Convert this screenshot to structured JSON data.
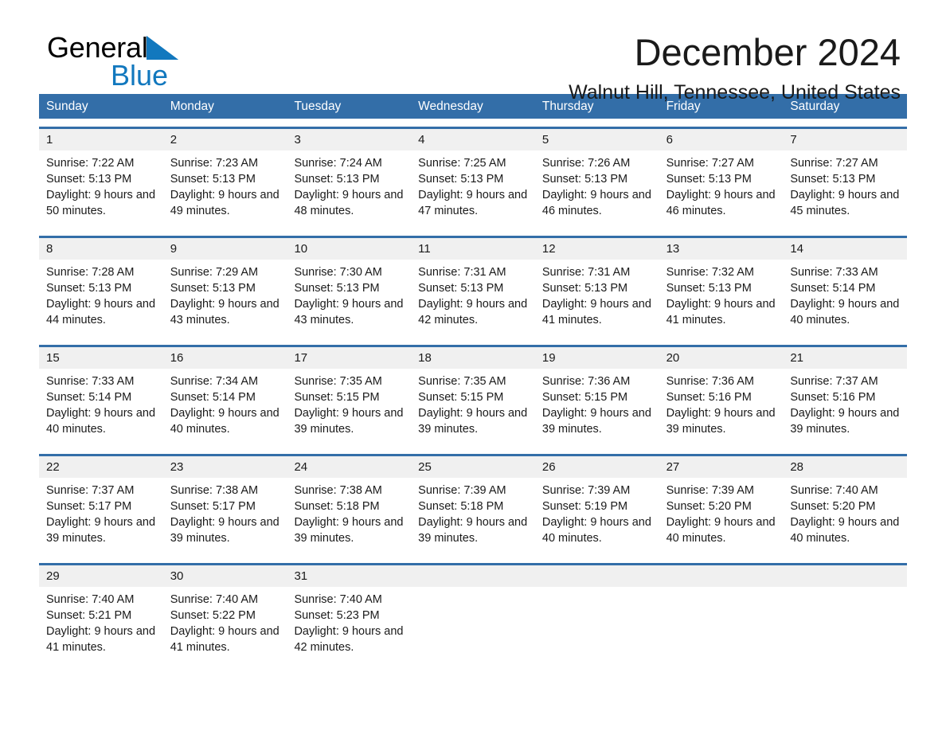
{
  "brand": {
    "name_part1": "General",
    "name_part2": "Blue",
    "triangle_color": "#1278be",
    "header_blue": "#336ea8"
  },
  "header": {
    "month_title": "December 2024",
    "location": "Walnut Hill, Tennessee, United States"
  },
  "weekdays": [
    "Sunday",
    "Monday",
    "Tuesday",
    "Wednesday",
    "Thursday",
    "Friday",
    "Saturday"
  ],
  "weeks": [
    {
      "days": [
        {
          "date": "1",
          "sunrise": "Sunrise: 7:22 AM",
          "sunset": "Sunset: 5:13 PM",
          "daylight": "Daylight: 9 hours and 50 minutes."
        },
        {
          "date": "2",
          "sunrise": "Sunrise: 7:23 AM",
          "sunset": "Sunset: 5:13 PM",
          "daylight": "Daylight: 9 hours and 49 minutes."
        },
        {
          "date": "3",
          "sunrise": "Sunrise: 7:24 AM",
          "sunset": "Sunset: 5:13 PM",
          "daylight": "Daylight: 9 hours and 48 minutes."
        },
        {
          "date": "4",
          "sunrise": "Sunrise: 7:25 AM",
          "sunset": "Sunset: 5:13 PM",
          "daylight": "Daylight: 9 hours and 47 minutes."
        },
        {
          "date": "5",
          "sunrise": "Sunrise: 7:26 AM",
          "sunset": "Sunset: 5:13 PM",
          "daylight": "Daylight: 9 hours and 46 minutes."
        },
        {
          "date": "6",
          "sunrise": "Sunrise: 7:27 AM",
          "sunset": "Sunset: 5:13 PM",
          "daylight": "Daylight: 9 hours and 46 minutes."
        },
        {
          "date": "7",
          "sunrise": "Sunrise: 7:27 AM",
          "sunset": "Sunset: 5:13 PM",
          "daylight": "Daylight: 9 hours and 45 minutes."
        }
      ]
    },
    {
      "days": [
        {
          "date": "8",
          "sunrise": "Sunrise: 7:28 AM",
          "sunset": "Sunset: 5:13 PM",
          "daylight": "Daylight: 9 hours and 44 minutes."
        },
        {
          "date": "9",
          "sunrise": "Sunrise: 7:29 AM",
          "sunset": "Sunset: 5:13 PM",
          "daylight": "Daylight: 9 hours and 43 minutes."
        },
        {
          "date": "10",
          "sunrise": "Sunrise: 7:30 AM",
          "sunset": "Sunset: 5:13 PM",
          "daylight": "Daylight: 9 hours and 43 minutes."
        },
        {
          "date": "11",
          "sunrise": "Sunrise: 7:31 AM",
          "sunset": "Sunset: 5:13 PM",
          "daylight": "Daylight: 9 hours and 42 minutes."
        },
        {
          "date": "12",
          "sunrise": "Sunrise: 7:31 AM",
          "sunset": "Sunset: 5:13 PM",
          "daylight": "Daylight: 9 hours and 41 minutes."
        },
        {
          "date": "13",
          "sunrise": "Sunrise: 7:32 AM",
          "sunset": "Sunset: 5:13 PM",
          "daylight": "Daylight: 9 hours and 41 minutes."
        },
        {
          "date": "14",
          "sunrise": "Sunrise: 7:33 AM",
          "sunset": "Sunset: 5:14 PM",
          "daylight": "Daylight: 9 hours and 40 minutes."
        }
      ]
    },
    {
      "days": [
        {
          "date": "15",
          "sunrise": "Sunrise: 7:33 AM",
          "sunset": "Sunset: 5:14 PM",
          "daylight": "Daylight: 9 hours and 40 minutes."
        },
        {
          "date": "16",
          "sunrise": "Sunrise: 7:34 AM",
          "sunset": "Sunset: 5:14 PM",
          "daylight": "Daylight: 9 hours and 40 minutes."
        },
        {
          "date": "17",
          "sunrise": "Sunrise: 7:35 AM",
          "sunset": "Sunset: 5:15 PM",
          "daylight": "Daylight: 9 hours and 39 minutes."
        },
        {
          "date": "18",
          "sunrise": "Sunrise: 7:35 AM",
          "sunset": "Sunset: 5:15 PM",
          "daylight": "Daylight: 9 hours and 39 minutes."
        },
        {
          "date": "19",
          "sunrise": "Sunrise: 7:36 AM",
          "sunset": "Sunset: 5:15 PM",
          "daylight": "Daylight: 9 hours and 39 minutes."
        },
        {
          "date": "20",
          "sunrise": "Sunrise: 7:36 AM",
          "sunset": "Sunset: 5:16 PM",
          "daylight": "Daylight: 9 hours and 39 minutes."
        },
        {
          "date": "21",
          "sunrise": "Sunrise: 7:37 AM",
          "sunset": "Sunset: 5:16 PM",
          "daylight": "Daylight: 9 hours and 39 minutes."
        }
      ]
    },
    {
      "days": [
        {
          "date": "22",
          "sunrise": "Sunrise: 7:37 AM",
          "sunset": "Sunset: 5:17 PM",
          "daylight": "Daylight: 9 hours and 39 minutes."
        },
        {
          "date": "23",
          "sunrise": "Sunrise: 7:38 AM",
          "sunset": "Sunset: 5:17 PM",
          "daylight": "Daylight: 9 hours and 39 minutes."
        },
        {
          "date": "24",
          "sunrise": "Sunrise: 7:38 AM",
          "sunset": "Sunset: 5:18 PM",
          "daylight": "Daylight: 9 hours and 39 minutes."
        },
        {
          "date": "25",
          "sunrise": "Sunrise: 7:39 AM",
          "sunset": "Sunset: 5:18 PM",
          "daylight": "Daylight: 9 hours and 39 minutes."
        },
        {
          "date": "26",
          "sunrise": "Sunrise: 7:39 AM",
          "sunset": "Sunset: 5:19 PM",
          "daylight": "Daylight: 9 hours and 40 minutes."
        },
        {
          "date": "27",
          "sunrise": "Sunrise: 7:39 AM",
          "sunset": "Sunset: 5:20 PM",
          "daylight": "Daylight: 9 hours and 40 minutes."
        },
        {
          "date": "28",
          "sunrise": "Sunrise: 7:40 AM",
          "sunset": "Sunset: 5:20 PM",
          "daylight": "Daylight: 9 hours and 40 minutes."
        }
      ]
    },
    {
      "days": [
        {
          "date": "29",
          "sunrise": "Sunrise: 7:40 AM",
          "sunset": "Sunset: 5:21 PM",
          "daylight": "Daylight: 9 hours and 41 minutes."
        },
        {
          "date": "30",
          "sunrise": "Sunrise: 7:40 AM",
          "sunset": "Sunset: 5:22 PM",
          "daylight": "Daylight: 9 hours and 41 minutes."
        },
        {
          "date": "31",
          "sunrise": "Sunrise: 7:40 AM",
          "sunset": "Sunset: 5:23 PM",
          "daylight": "Daylight: 9 hours and 42 minutes."
        },
        {
          "date": "",
          "sunrise": "",
          "sunset": "",
          "daylight": ""
        },
        {
          "date": "",
          "sunrise": "",
          "sunset": "",
          "daylight": ""
        },
        {
          "date": "",
          "sunrise": "",
          "sunset": "",
          "daylight": ""
        },
        {
          "date": "",
          "sunrise": "",
          "sunset": "",
          "daylight": ""
        }
      ]
    }
  ]
}
